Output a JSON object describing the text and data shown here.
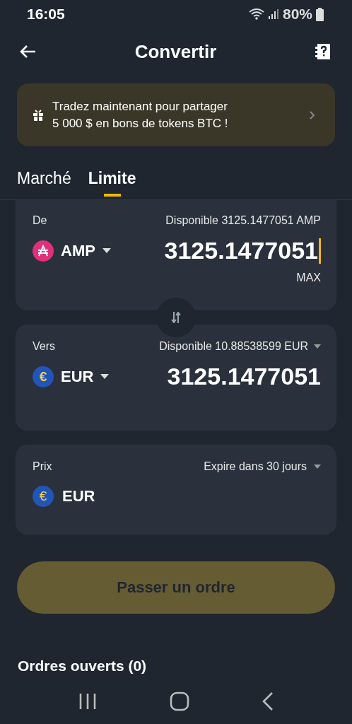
{
  "status_bar": {
    "time": "16:05",
    "battery": "80%"
  },
  "header": {
    "title": "Convertir"
  },
  "banner": {
    "line1": "Tradez maintenant pour partager",
    "line2": "5 000 $ en bons de tokens BTC !"
  },
  "tabs": [
    {
      "label": "Marché",
      "selected": false
    },
    {
      "label": "Limite",
      "selected": true
    }
  ],
  "from": {
    "label": "De",
    "available": "Disponible 3125.1477051 AMP",
    "currency": "AMP",
    "amount": "3125.1477051",
    "max": "MAX"
  },
  "to": {
    "label": "Vers",
    "available": "Disponible 10.88538599 EUR",
    "currency": "EUR",
    "coin_symbol": "€",
    "amount": "3125.1477051"
  },
  "price": {
    "label": "Prix",
    "expiry": "Expire dans 30 jours",
    "currency": "EUR",
    "coin_symbol": "€"
  },
  "order_button": {
    "label": "Passer un ordre",
    "disabled": true
  },
  "open_orders": {
    "title": "Ordres ouverts (0)"
  }
}
